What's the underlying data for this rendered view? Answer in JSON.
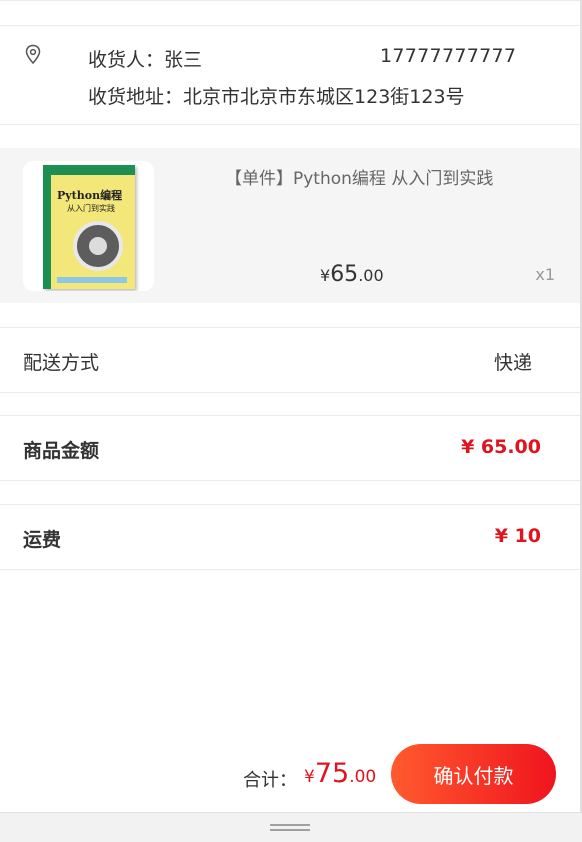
{
  "address": {
    "icon": "location-pin-icon",
    "receiver_label": "收货人：",
    "receiver_name": "张三",
    "phone": "17777777777",
    "address_label": "收货地址：",
    "address_value": "北京市北京市东城区123街123号"
  },
  "product": {
    "title": "【单件】Python编程 从入门到实践",
    "price_currency": "¥",
    "price_int": "65",
    "price_dec": ".00",
    "quantity": "x1",
    "cover_title": "Python编程",
    "cover_subtitle": "从入门到实践"
  },
  "delivery": {
    "label": "配送方式",
    "value": "快递"
  },
  "amount": {
    "label": "商品金额",
    "value": "¥ 65.00"
  },
  "shipping": {
    "label": "运费",
    "value": "¥ 10"
  },
  "footer": {
    "total_label": "合计：",
    "total_currency": "¥",
    "total_int": "75",
    "total_dec": ".00",
    "pay_button": "确认付款"
  },
  "colors": {
    "accent_red": "#e0141e",
    "button_gradient_start": "#ff5a2e",
    "button_gradient_end": "#f0141e"
  }
}
